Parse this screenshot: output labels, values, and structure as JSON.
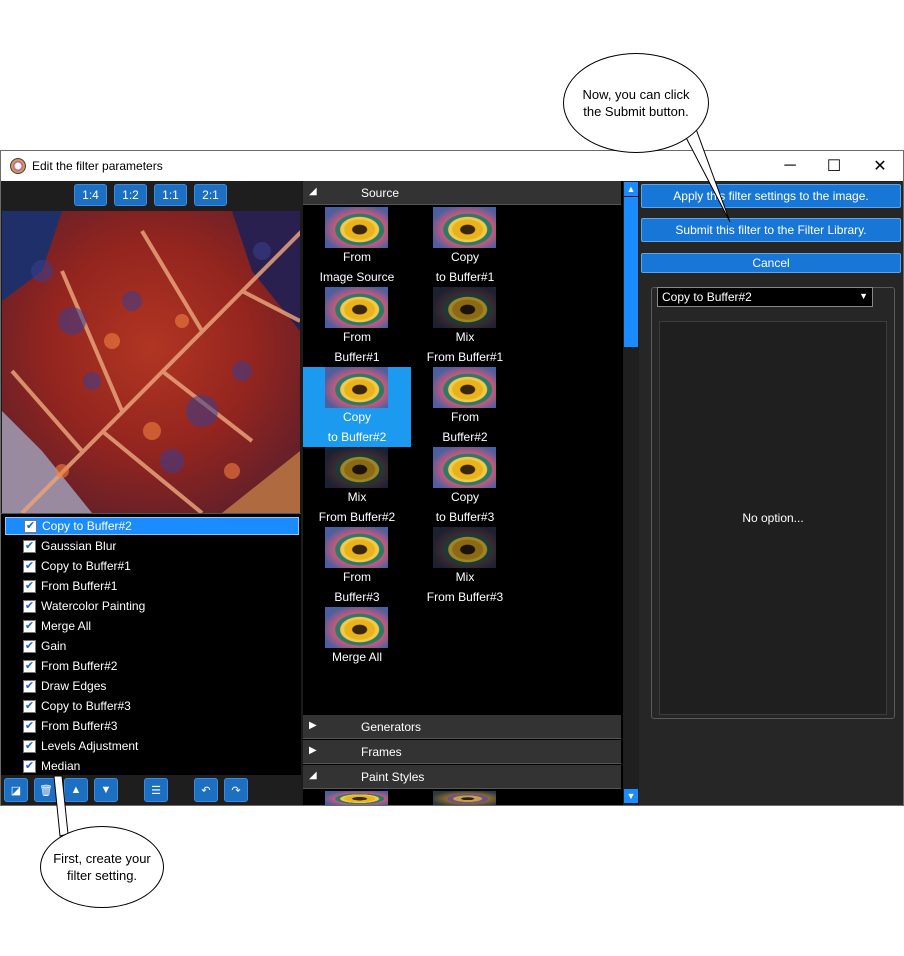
{
  "callouts": {
    "top": {
      "line1": "Now, you can click",
      "line2": "the Submit button."
    },
    "bottom": {
      "line1": "First, create your",
      "line2": "filter setting."
    }
  },
  "window": {
    "title": "Edit the filter parameters",
    "controls": {
      "minimize": "─",
      "maximize": "☐",
      "close": "✕"
    }
  },
  "zoom_buttons": [
    "1:4",
    "1:2",
    "1:1",
    "2:1"
  ],
  "filter_list": [
    {
      "label": "Copy to Buffer#2",
      "checked": true,
      "selected": true
    },
    {
      "label": "Gaussian Blur",
      "checked": true
    },
    {
      "label": "Copy to Buffer#1",
      "checked": true
    },
    {
      "label": "From Buffer#1",
      "checked": true
    },
    {
      "label": "Watercolor Painting",
      "checked": true
    },
    {
      "label": "Merge All",
      "checked": true
    },
    {
      "label": "Gain",
      "checked": true
    },
    {
      "label": "From Buffer#2",
      "checked": true
    },
    {
      "label": "Draw Edges",
      "checked": true
    },
    {
      "label": "Copy to Buffer#3",
      "checked": true
    },
    {
      "label": "From Buffer#3",
      "checked": true
    },
    {
      "label": "Levels Adjustment",
      "checked": true
    },
    {
      "label": "Median",
      "checked": true
    }
  ],
  "checkmark": "✔",
  "toolbar_icons": [
    "new-icon",
    "delete-icon",
    "move-up-icon",
    "move-down-icon",
    "menu-icon",
    "undo-icon",
    "redo-icon"
  ],
  "categories": {
    "source": {
      "label": "Source",
      "arrow": "◢"
    },
    "generators": {
      "label": "Generators",
      "arrow": "▶"
    },
    "frames": {
      "label": "Frames",
      "arrow": "▶"
    },
    "paint_styles": {
      "label": "Paint Styles",
      "arrow": "◢"
    }
  },
  "source_items": [
    {
      "line1": "From",
      "line2": "Image Source"
    },
    {
      "line1": "Copy",
      "line2": "to Buffer#1"
    },
    {
      "line1": "From",
      "line2": "Buffer#1"
    },
    {
      "line1": "Mix",
      "line2": "From Buffer#1"
    },
    {
      "line1": "Copy",
      "line2": "to Buffer#2",
      "selected": true
    },
    {
      "line1": "From",
      "line2": "Buffer#2"
    },
    {
      "line1": "Mix",
      "line2": "From Buffer#2"
    },
    {
      "line1": "Copy",
      "line2": "to Buffer#3"
    },
    {
      "line1": "From",
      "line2": "Buffer#3"
    },
    {
      "line1": "Mix",
      "line2": "From Buffer#3"
    },
    {
      "line1": "Merge All",
      "line2": ""
    }
  ],
  "right_panel": {
    "apply_button": "Apply this filter settings to the image.",
    "submit_button": "Submit this filter to the Filter Library.",
    "cancel_button": "Cancel",
    "selected_filter": "Copy to Buffer#2",
    "no_option_text": "No option..."
  }
}
